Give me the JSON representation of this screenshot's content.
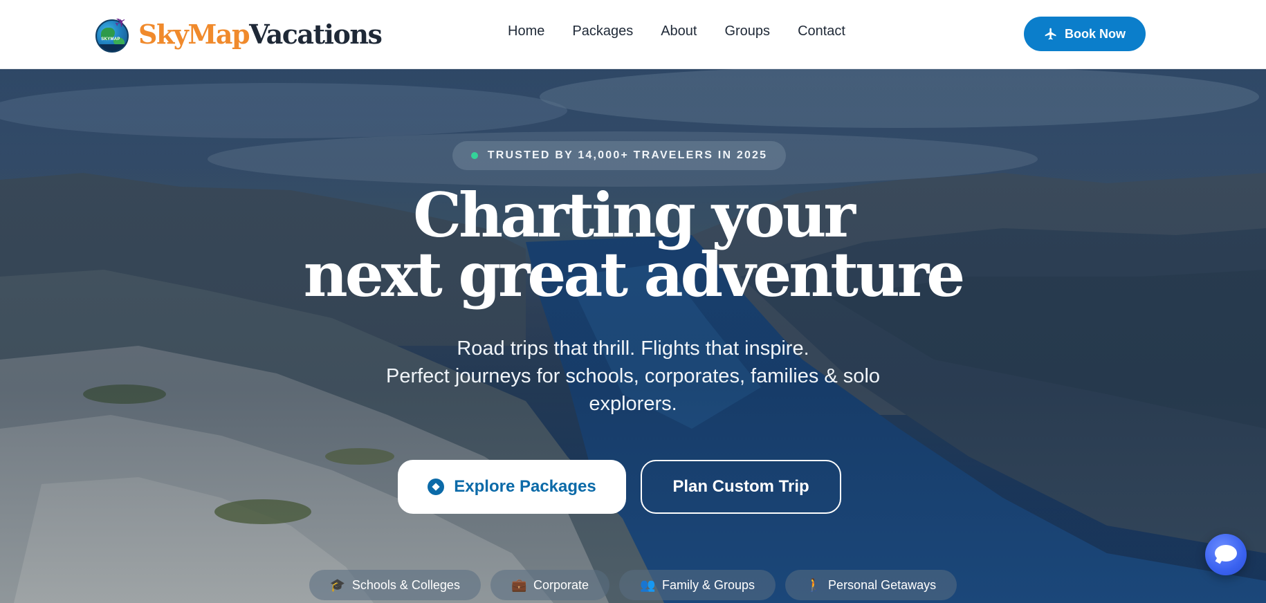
{
  "brand": {
    "name_part1": "SkyMap",
    "name_part2": "Vacations",
    "badge_text": "SKYMAP"
  },
  "nav": {
    "items": [
      "Home",
      "Packages",
      "About",
      "Groups",
      "Contact"
    ]
  },
  "header": {
    "book_label": "Book Now"
  },
  "hero": {
    "trust_text": "TRUSTED BY 14,000+ TRAVELERS IN 2025",
    "headline_line1": "Charting your",
    "headline_line2": "next great adventure",
    "sub_line1": "Road trips that thrill. Flights that inspire.",
    "sub_line2": "Perfect journeys for schools, corporates, families & solo",
    "sub_line3": "explorers.",
    "explore_label": "Explore Packages",
    "custom_label": "Plan Custom Trip"
  },
  "chips": [
    {
      "label": "Schools & Colleges",
      "icon": "graduation-cap-icon"
    },
    {
      "label": "Corporate",
      "icon": "briefcase-icon"
    },
    {
      "label": "Family & Groups",
      "icon": "users-icon"
    },
    {
      "label": "Personal Getaways",
      "icon": "person-hiking-icon"
    }
  ],
  "colors": {
    "accent": "#0b7ecb",
    "brand_orange": "#f08a2c",
    "brand_dark": "#1f2937",
    "trust_dot": "#34d399"
  }
}
